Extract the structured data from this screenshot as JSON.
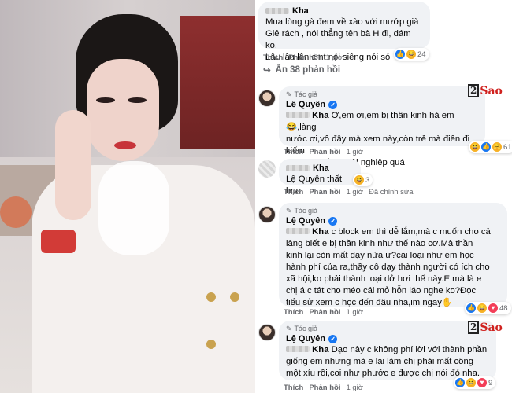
{
  "comments": [
    {
      "author": "Kha",
      "lines": [
        "Mua lòng gà đem về xào với mướp già",
        "Giẻ rách , nói thẳng tên bà H đi, dám ko.",
        "Lâu lâu lên cmt nói siêng nói sỏ"
      ],
      "actions": {
        "like": "Thích",
        "reply": "Phản hồi",
        "time": "1 giờ"
      },
      "reaction_count": "24"
    },
    {
      "author": "Lệ Quyên",
      "role": "Tác giả",
      "mention": "Kha",
      "lines": [
        " Ơ,em ơi,em bị thần kinh hả em😂,làng",
        "nước ơi,vô đây mà xem này,còn trẻ mà điên đi kiếm",
        "chuyện thế này tội nghiệp quá"
      ],
      "actions": {
        "like": "Thích",
        "reply": "Phản hồi",
        "time": "1 giờ"
      },
      "reaction_count": "61"
    },
    {
      "author": "Kha",
      "text": "Lệ Quyên thất học",
      "actions": {
        "like": "Thích",
        "reply": "Phản hồi",
        "time": "1 giờ",
        "edited": "Đã chỉnh sửa"
      },
      "reaction_count": "3"
    },
    {
      "author": "Lệ Quyên",
      "role": "Tác giả",
      "mention": "Kha",
      "lines": [
        " c block em thì dễ lắm,mà c muốn cho cả",
        "làng biết e bị thần kinh như thế nào cơ.Mà thần",
        "kinh lại còn mất dạy nữa ư?cái loại như em học",
        "hành phí của ra,thầy cô dạy thành người có ích cho",
        "xã hội,ko phải thành loại dở hơi thế này.E mà là e",
        "chị á,c tát cho méo cái mỏ hỗn láo nghe ko?Đọc",
        "tiểu sử xem c học đến đâu nha,im ngay✋"
      ],
      "actions": {
        "like": "Thích",
        "reply": "Phản hồi",
        "time": "1 giờ"
      },
      "reaction_count": "48"
    },
    {
      "author": "Lệ Quyên",
      "role": "Tác giả",
      "mention": "Kha",
      "lines": [
        " Dạo này c không phí lời với thành phần",
        "giống em nhưng mà e lại làm chị phải mất công",
        "một xíu rồi,coi như phước e được chị nói đó nha."
      ],
      "actions": {
        "like": "Thích",
        "reply": "Phản hồi",
        "time": "1 giờ"
      },
      "reaction_count": "9"
    }
  ],
  "hidden_replies": "Ẩn 38 phản hồi",
  "watermark": {
    "box": "2",
    "text": "Sao"
  },
  "colors": {
    "bubble": "#f0f2f5",
    "meta": "#65676b",
    "verified": "#1877f2",
    "watermark": "#d0221f"
  }
}
